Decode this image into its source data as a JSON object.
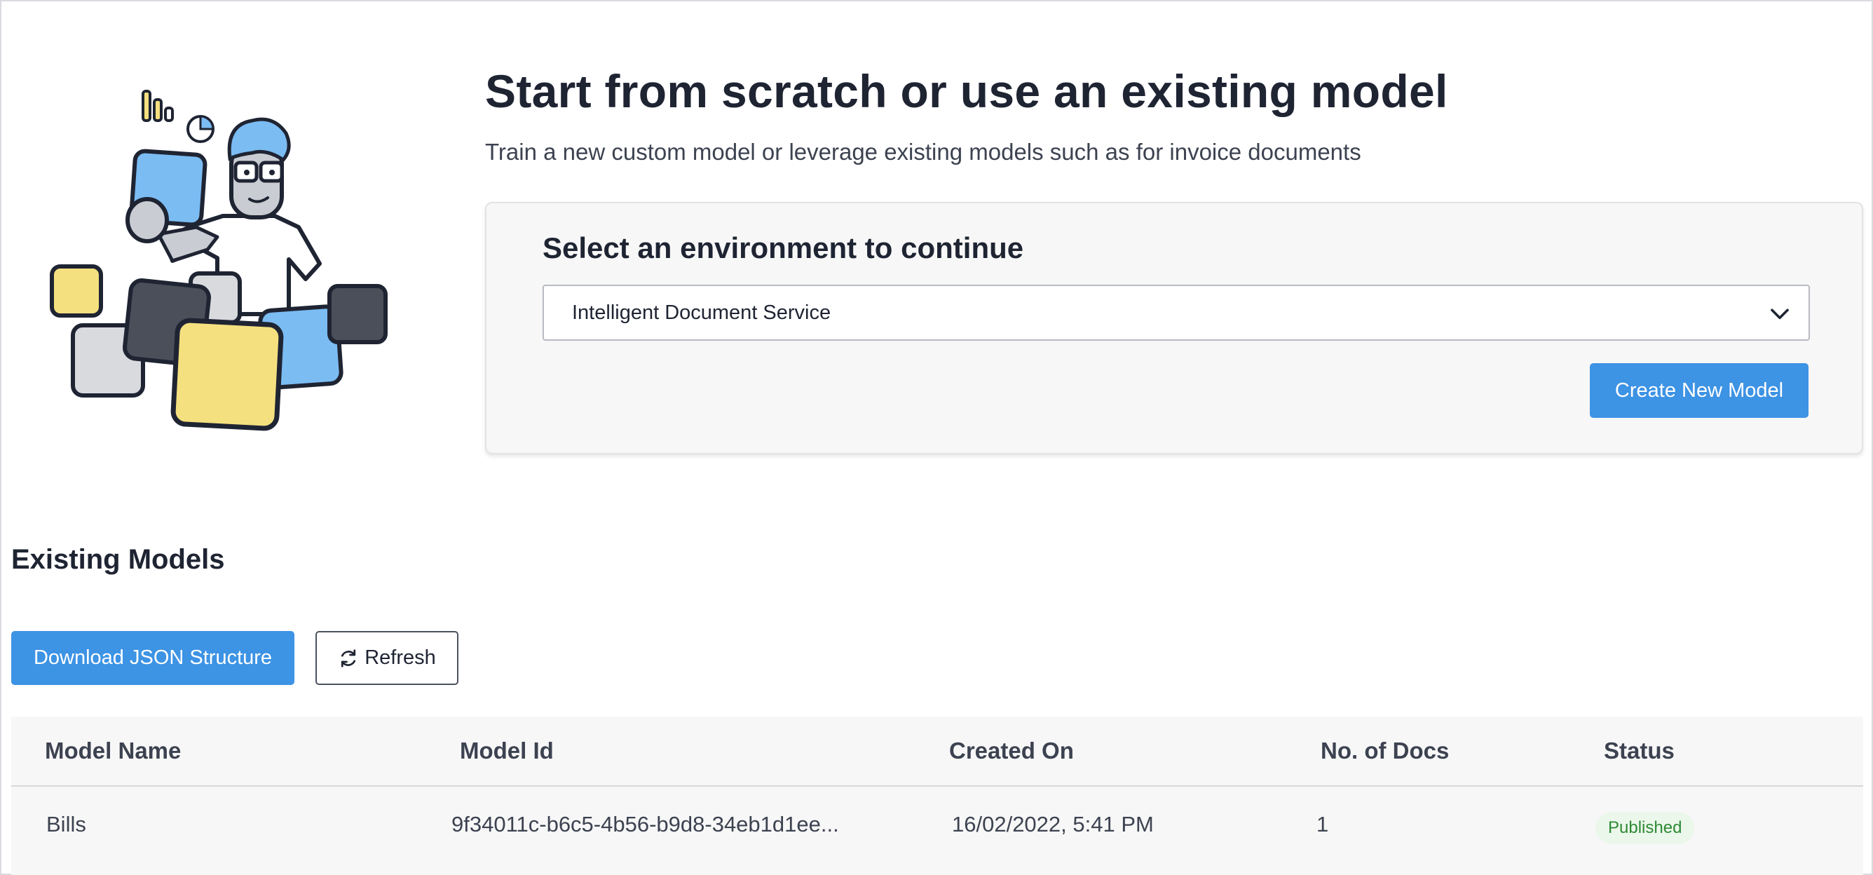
{
  "hero": {
    "title": "Start from scratch or use an existing model",
    "subtitle": "Train a new custom model or leverage existing models such as for invoice documents"
  },
  "environment": {
    "title": "Select an environment to continue",
    "selected": "Intelligent Document Service",
    "create_label": "Create New Model"
  },
  "existing": {
    "title": "Existing Models",
    "download_label": "Download JSON Structure",
    "refresh_label": "Refresh"
  },
  "table": {
    "columns": [
      "Model Name",
      "Model Id",
      "Created On",
      "No. of Docs",
      "Status"
    ],
    "rows": [
      {
        "name": "Bills",
        "id": "9f34011c-b6c5-4b56-b9d8-34eb1d1ee...",
        "created": "16/02/2022, 5:41 PM",
        "docs": "1",
        "status": "Published"
      }
    ]
  },
  "colors": {
    "accent": "#3d93e4",
    "status_published_bg": "#ebf7ea",
    "status_published_text": "#2e8a36"
  },
  "icons": [
    "illustration-person",
    "chevron-down-icon",
    "refresh-icon"
  ]
}
